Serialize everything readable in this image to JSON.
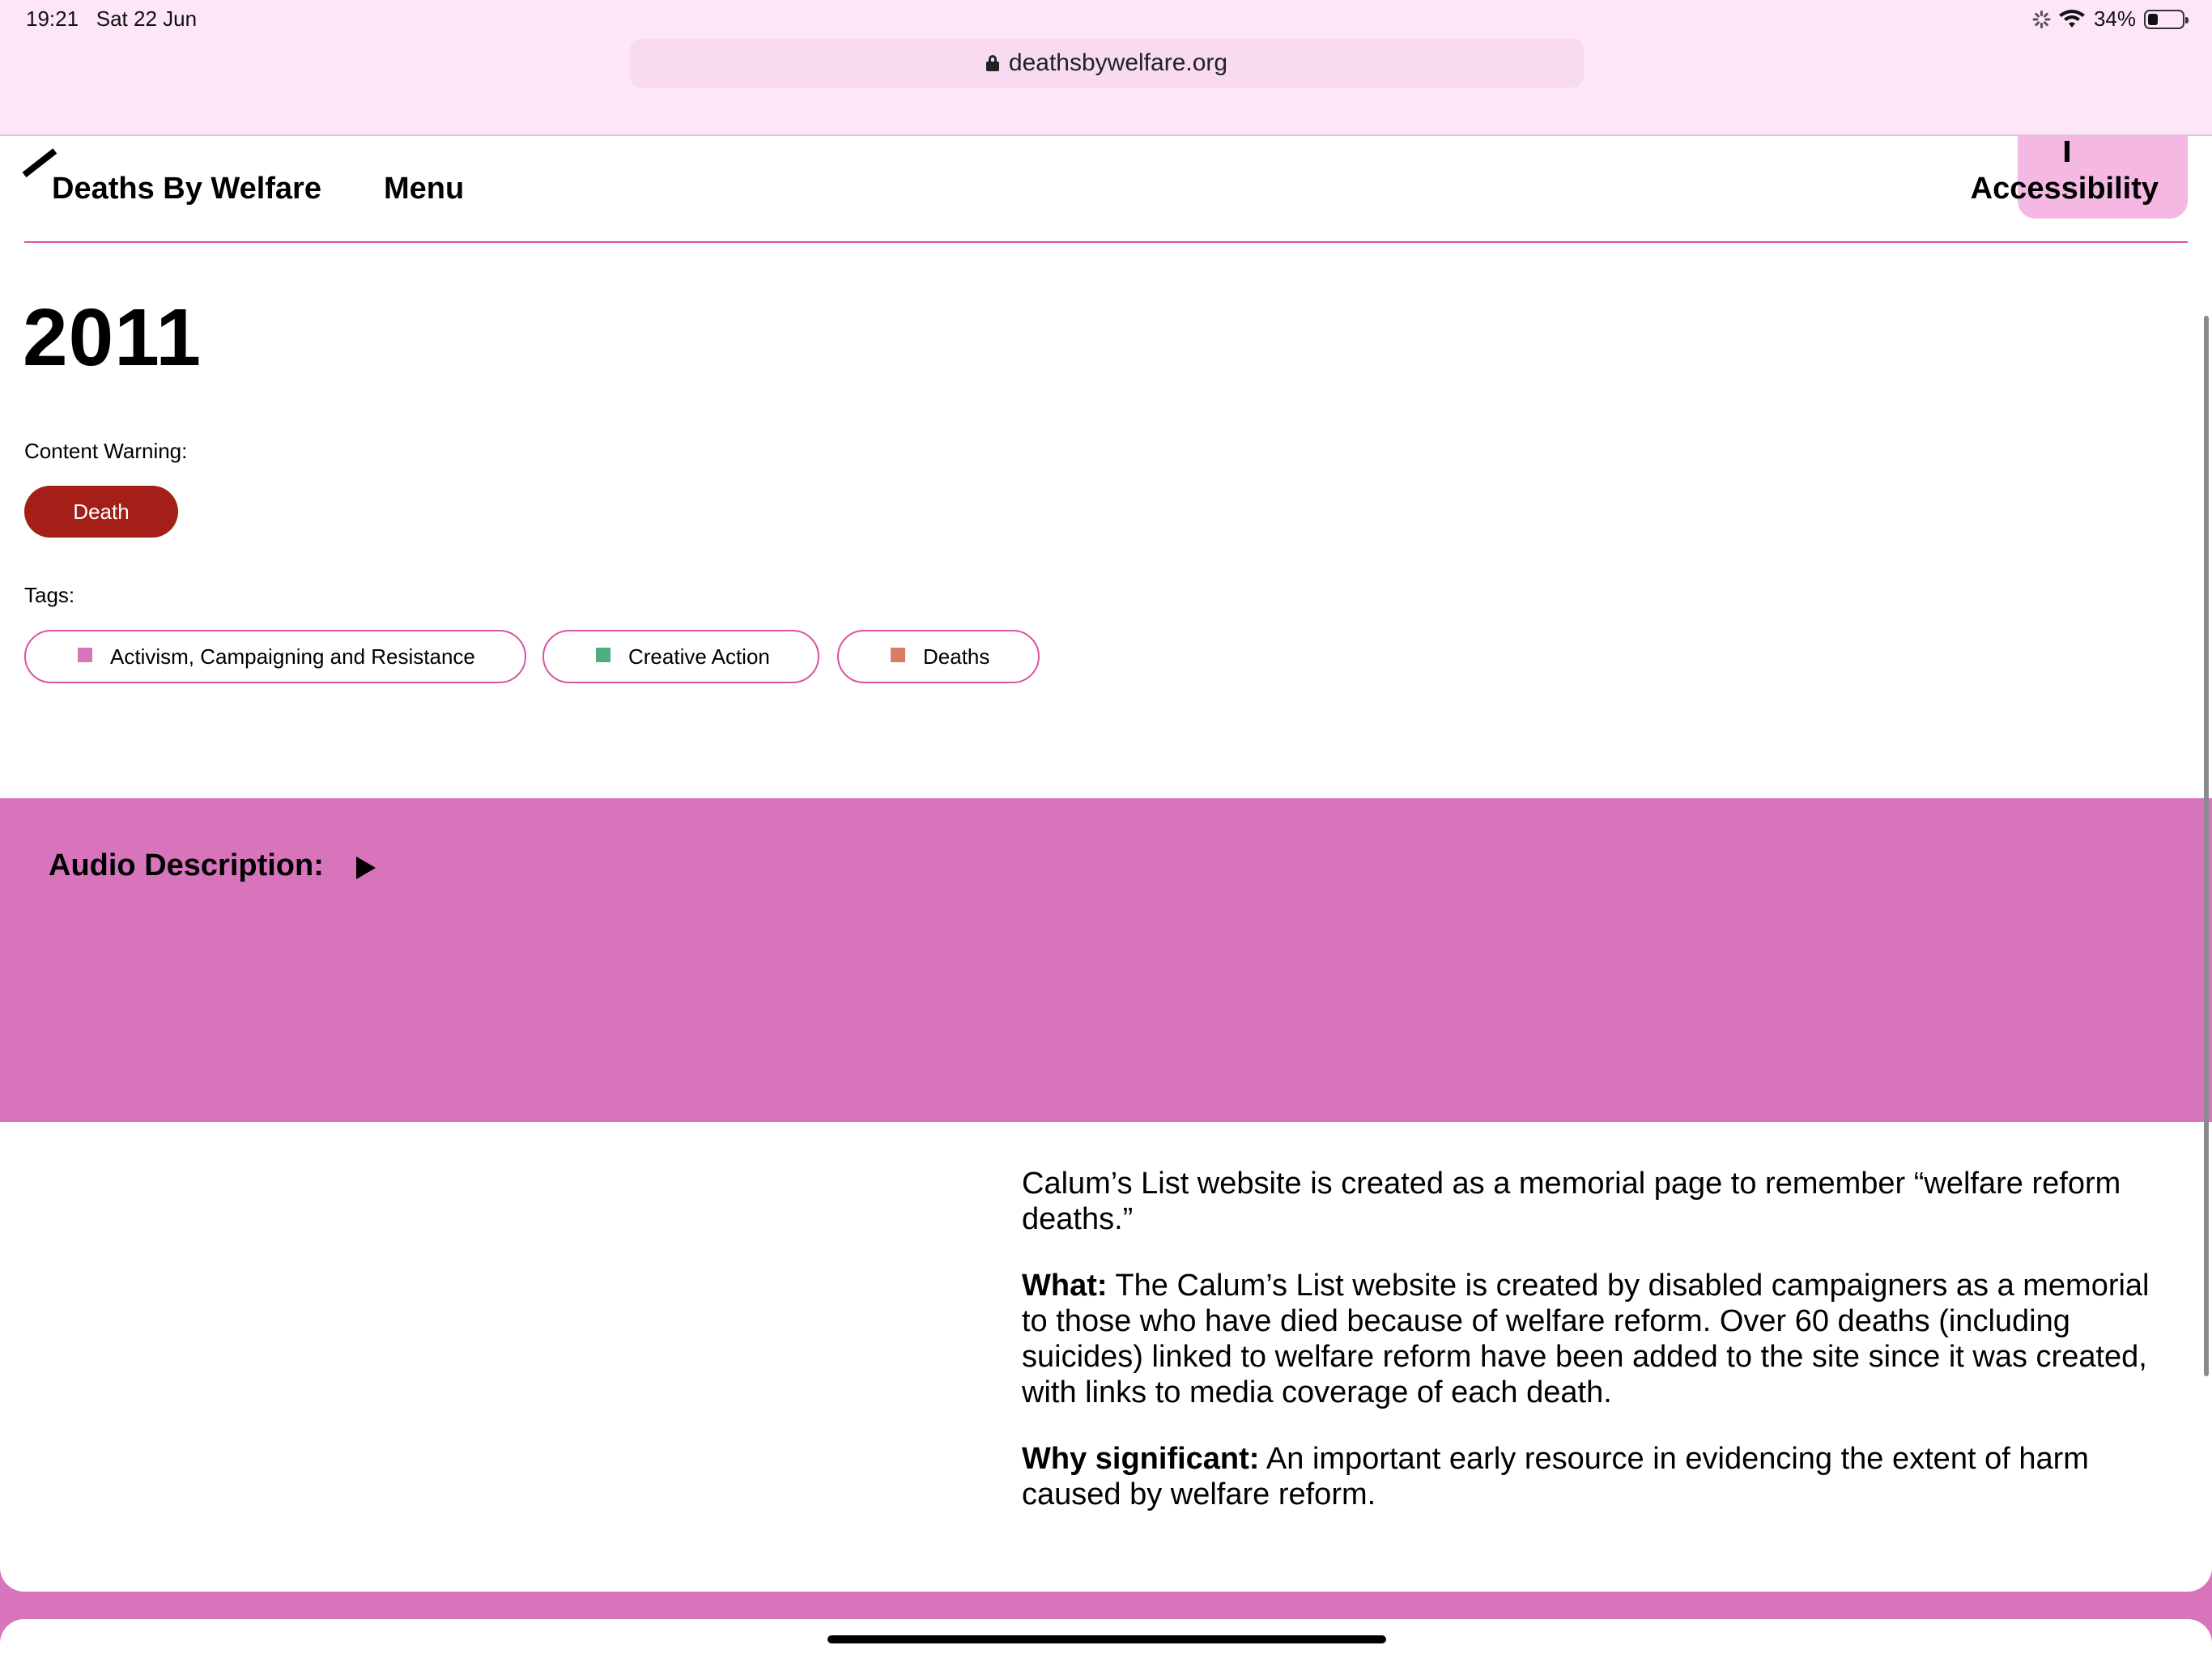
{
  "status_bar": {
    "time": "19:21",
    "date": "Sat 22 Jun",
    "battery": "34%"
  },
  "browser": {
    "url": "deathsbywelfare.org"
  },
  "header": {
    "brand": "Deaths By Welfare",
    "menu": "Menu",
    "accessibility": "Accessibility"
  },
  "page": {
    "year": "2011",
    "content_warning_label": "Content Warning:",
    "content_warning": "Death",
    "tags_label": "Tags:",
    "tags": [
      {
        "label": "Activism, Campaigning and Resistance",
        "color": "#d874bc"
      },
      {
        "label": "Creative Action",
        "color": "#4daf7c"
      },
      {
        "label": "Deaths",
        "color": "#d97c66"
      }
    ],
    "audio_label": "Audio Description:"
  },
  "article": {
    "intro": "Calum’s List website is created as a memorial page to remember “welfare reform deaths.”",
    "what_label": "What:",
    "what_text": " The Calum’s List website is created by disabled campaigners as a memorial to those who have died because of welfare reform. Over 60 deaths (including suicides) linked to welfare reform have been added to the site since it was created, with links to media coverage of each death.",
    "why_label": "Why significant:",
    "why_text": " An important early resource in evidencing the extent of harm caused by welfare reform."
  },
  "colors": {
    "accent_pink": "#d874bc",
    "warning_red": "#a31f17",
    "chrome_bg": "#fde6f8"
  }
}
